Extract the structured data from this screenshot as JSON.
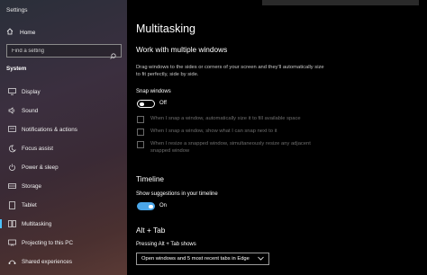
{
  "window": {
    "title": "Settings"
  },
  "sidebar": {
    "home_label": "Home",
    "search_placeholder": "Find a setting",
    "section_title": "System",
    "items": [
      {
        "label": "Display",
        "icon": "monitor-icon"
      },
      {
        "label": "Sound",
        "icon": "speaker-icon"
      },
      {
        "label": "Notifications & actions",
        "icon": "notification-icon"
      },
      {
        "label": "Focus assist",
        "icon": "moon-icon"
      },
      {
        "label": "Power & sleep",
        "icon": "power-icon"
      },
      {
        "label": "Storage",
        "icon": "storage-icon"
      },
      {
        "label": "Tablet",
        "icon": "tablet-icon"
      },
      {
        "label": "Multitasking",
        "icon": "multitasking-icon",
        "active": true
      },
      {
        "label": "Projecting to this PC",
        "icon": "projector-icon"
      },
      {
        "label": "Shared experiences",
        "icon": "shared-icon"
      }
    ]
  },
  "main": {
    "title": "Multitasking",
    "windows_section": {
      "heading": "Work with multiple windows",
      "description": "Drag windows to the sides or corners of your screen and they'll automatically size to fit perfectly, side by side.",
      "snap_label": "Snap windows",
      "snap_state": "Off",
      "snap_on": false,
      "options": [
        "When I snap a window, automatically size it to fill available space",
        "When I snap a window, show what I can snap next to it",
        "When I resize a snapped window, simultaneously resize any adjacent snapped window"
      ]
    },
    "timeline_section": {
      "heading": "Timeline",
      "suggestions_label": "Show suggestions in your timeline",
      "suggestions_state": "On",
      "suggestions_on": true
    },
    "alttab_section": {
      "heading": "Alt + Tab",
      "label": "Pressing Alt + Tab shows",
      "selected": "Open windows and 5 most recent tabs in Edge"
    }
  },
  "colors": {
    "accent": "#4cc2ff",
    "toggle_on": "#4aa6e8"
  }
}
